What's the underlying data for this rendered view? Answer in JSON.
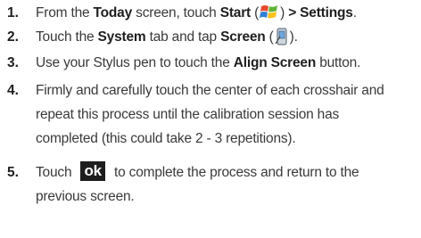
{
  "steps": [
    {
      "number": "1.",
      "lines": [
        {
          "t1": "From the ",
          "b1": "Today",
          "t2": " screen, touch ",
          "b2": "Start",
          "t3": " (",
          "icon": "windows-start-icon",
          "t4": ") ",
          "b3": "> Settings",
          "t5": "."
        }
      ]
    },
    {
      "number": "2.",
      "lines": [
        {
          "t1": "Touch the ",
          "b1": "System",
          "t2": " tab and tap ",
          "b2": "Screen",
          "t3": " (",
          "icon": "device-screen-icon",
          "t4": ")."
        }
      ]
    },
    {
      "number": "3.",
      "lines": [
        {
          "t1": "Use your Stylus pen to touch the ",
          "b1": "Align Screen",
          "t2": " button."
        }
      ]
    },
    {
      "number": "4.",
      "lines": [
        "Firmly and carefully touch the center of each crosshair and",
        "repeat this process until the calibration session has",
        "completed (this could take 2 - 3 repetitions)."
      ]
    },
    {
      "number": "5.",
      "lines": [
        {
          "t1": "Touch ",
          "button": "ok",
          "t2": " to complete the process and return to the"
        },
        "previous screen."
      ]
    }
  ]
}
